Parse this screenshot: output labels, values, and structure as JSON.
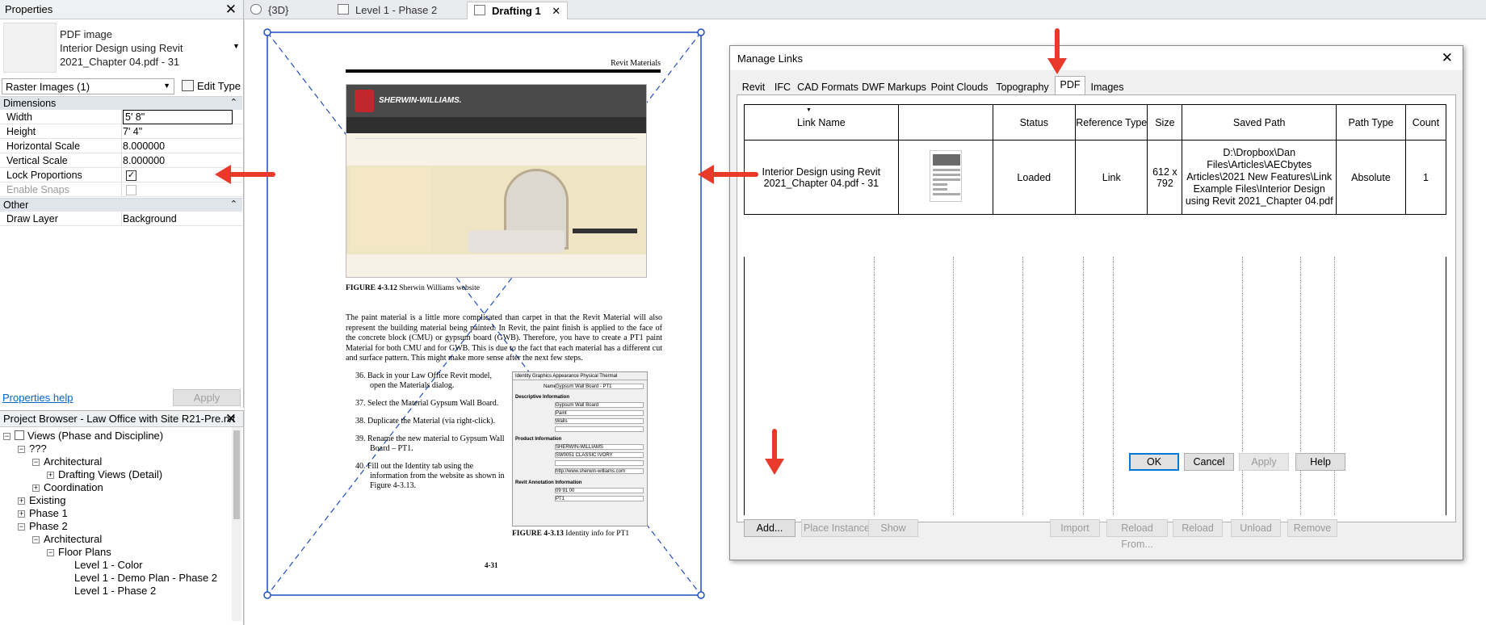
{
  "properties": {
    "title": "Properties",
    "type_line1": "PDF image",
    "type_line2": "Interior Design using Revit",
    "type_line3": "2021_Chapter 04.pdf - 31",
    "selector": "Raster Images (1)",
    "edit_type": "Edit Type",
    "groups": {
      "dimensions": "Dimensions",
      "other": "Other"
    },
    "rows": [
      {
        "label": "Width",
        "value": "5'  8\""
      },
      {
        "label": "Height",
        "value": "7'  4\""
      },
      {
        "label": "Horizontal Scale",
        "value": "8.000000"
      },
      {
        "label": "Vertical Scale",
        "value": "8.000000"
      },
      {
        "label": "Lock Proportions",
        "value": "✓"
      },
      {
        "label": "Enable Snaps",
        "value": ""
      },
      {
        "label": "Draw Layer",
        "value": "Background"
      }
    ],
    "help": "Properties help",
    "apply": "Apply"
  },
  "browser": {
    "title": "Project Browser - Law Office with Site R21-Pre.rvt",
    "items": [
      {
        "label": "Views (Phase and Discipline)",
        "toggle": "−"
      },
      {
        "label": "???",
        "toggle": "−"
      },
      {
        "label": "Architectural",
        "toggle": "−"
      },
      {
        "label": "Drafting Views (Detail)",
        "toggle": "+"
      },
      {
        "label": "Coordination",
        "toggle": "+"
      },
      {
        "label": "Existing",
        "toggle": "+"
      },
      {
        "label": "Phase 1",
        "toggle": "+"
      },
      {
        "label": "Phase 2",
        "toggle": "−"
      },
      {
        "label": "Architectural",
        "toggle": "−"
      },
      {
        "label": "Floor Plans",
        "toggle": "−"
      },
      {
        "label": "Level 1 - Color",
        "toggle": ""
      },
      {
        "label": "Level 1 - Demo Plan - Phase 2",
        "toggle": ""
      },
      {
        "label": "Level 1 - Phase 2",
        "toggle": ""
      }
    ]
  },
  "tabs": [
    {
      "label": "{3D}"
    },
    {
      "label": "Level 1 - Phase 2"
    },
    {
      "label": "Drafting 1",
      "close": "✕"
    }
  ],
  "page": {
    "running_head": "Revit Materials",
    "brand": "SHERWIN-WILLIAMS.",
    "fig1_num": "FIGURE 4-3.12",
    "fig1_text": "Sherwin Williams website",
    "body": "The paint material is a little more complicated than carpet in that the Revit Material will also represent the building material being painted. In Revit, the paint finish is applied to the face of the concrete block (CMU) or gypsum board (GWB). Therefore, you have to create a PT1 paint Material for both CMU and for GWB. This is due to the fact that each material has a different cut and surface pattern. This might make more sense after the next few steps.",
    "steps": [
      "36. Back in your Law Office Revit model, open the Materials dialog.",
      "37. Select the Material Gypsum Wall Board.",
      "38. Duplicate the Material (via right-click).",
      "39. Rename the new material to Gypsum Wall Board – PT1.",
      "40. Fill out the Identity tab using the information from the website as shown in Figure 4-3.13."
    ],
    "fig2_num": "FIGURE 4-3.13",
    "fig2_text": "Identity info for PT1",
    "page_number": "4-31",
    "mat_dialog": {
      "tabs": "Identity  Graphics  Appearance  Physical  Thermal",
      "name_label": "Name",
      "name_value": "Gypsum Wall Board - PT1",
      "desc_head": "Descriptive Information",
      "desc_value": "Gypsum Wall Board",
      "class_value": "Paint",
      "comments_value": "Walls",
      "product_head": "Product Information",
      "manufacturer_value": "SHERWIN-WILLIAMS",
      "model_value": "SW0051 CLASSIC IVORY",
      "url_value": "http://www.sherwin-williams.com",
      "annotation_head": "Revit Annotation Information",
      "keynote_value": "09 91 00",
      "mark_value": "PT1"
    }
  },
  "dialog": {
    "title": "Manage Links",
    "tabs": [
      "Revit",
      "IFC",
      "CAD Formats",
      "DWF Markups",
      "Point Clouds",
      "Topography",
      "PDF",
      "Images"
    ],
    "columns": [
      "Link Name",
      "",
      "Status",
      "Reference Type",
      "Size",
      "Saved Path",
      "Path Type",
      "Count"
    ],
    "row": {
      "link_name": "Interior Design using Revit 2021_Chapter 04.pdf - 31",
      "status": "Loaded",
      "reference_type": "Link",
      "size": "612 x 792",
      "saved_path": "D:\\Dropbox\\Dan Files\\Articles\\AECbytes Articles\\2021 New Features\\Link Example Files\\Interior Design using Revit 2021_Chapter 04.pdf",
      "path_type": "Absolute",
      "count": "1"
    },
    "buttons": {
      "add": "Add...",
      "place_instance": "Place Instance",
      "show": "Show",
      "import": "Import",
      "reload_from": "Reload From...",
      "reload": "Reload",
      "unload": "Unload",
      "remove": "Remove",
      "ok": "OK",
      "cancel": "Cancel",
      "apply": "Apply",
      "help": "Help"
    }
  },
  "colors": {
    "arrow": "#e8392b",
    "selection": "#1f4fbf",
    "link": "#0066cc"
  }
}
